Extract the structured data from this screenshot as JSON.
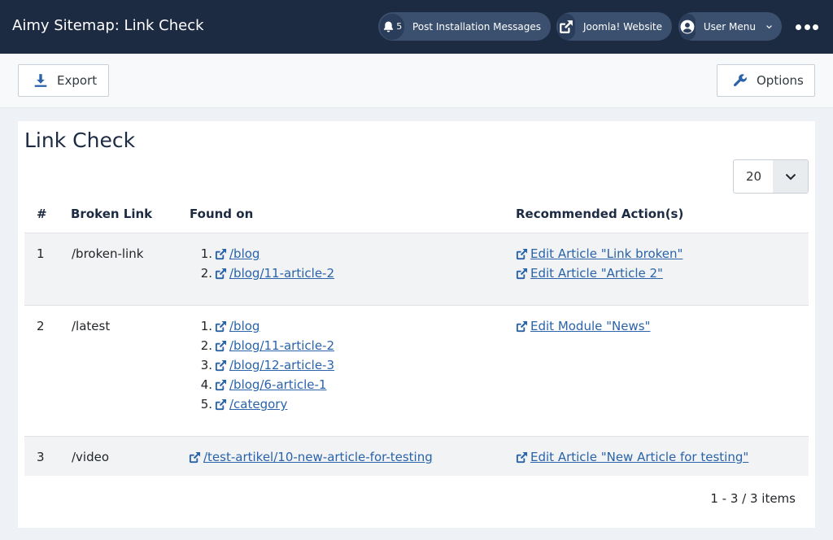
{
  "header": {
    "title": "Aimy Sitemap: Link Check",
    "messages_count": "5",
    "messages_label": "Post Installation Messages",
    "website_label": "Joomla! Website",
    "user_menu_label": "User Menu"
  },
  "toolbar": {
    "export_label": "Export",
    "options_label": "Options"
  },
  "main": {
    "page_title": "Link Check",
    "limit_value": "20",
    "columns": {
      "num": "#",
      "broken_link": "Broken Link",
      "found_on": "Found on",
      "actions": "Recommended Action(s)"
    },
    "rows": [
      {
        "num": "1",
        "broken_link": "/broken-link",
        "found_on": [
          "/blog",
          "/blog/11-article-2"
        ],
        "actions": [
          "Edit Article \"Link broken\"",
          "Edit Article \"Article 2\""
        ]
      },
      {
        "num": "2",
        "broken_link": "/latest",
        "found_on": [
          "/blog",
          "/blog/11-article-2",
          "/blog/12-article-3",
          "/blog/6-article-1",
          "/category"
        ],
        "actions": [
          "Edit Module \"News\""
        ]
      },
      {
        "num": "3",
        "broken_link": "/video",
        "found_on_single": "/test-artikel/10-new-article-for-testing",
        "actions": [
          "Edit Article \"New Article for testing\""
        ]
      }
    ],
    "pagination": "1 - 3 / 3 items"
  }
}
